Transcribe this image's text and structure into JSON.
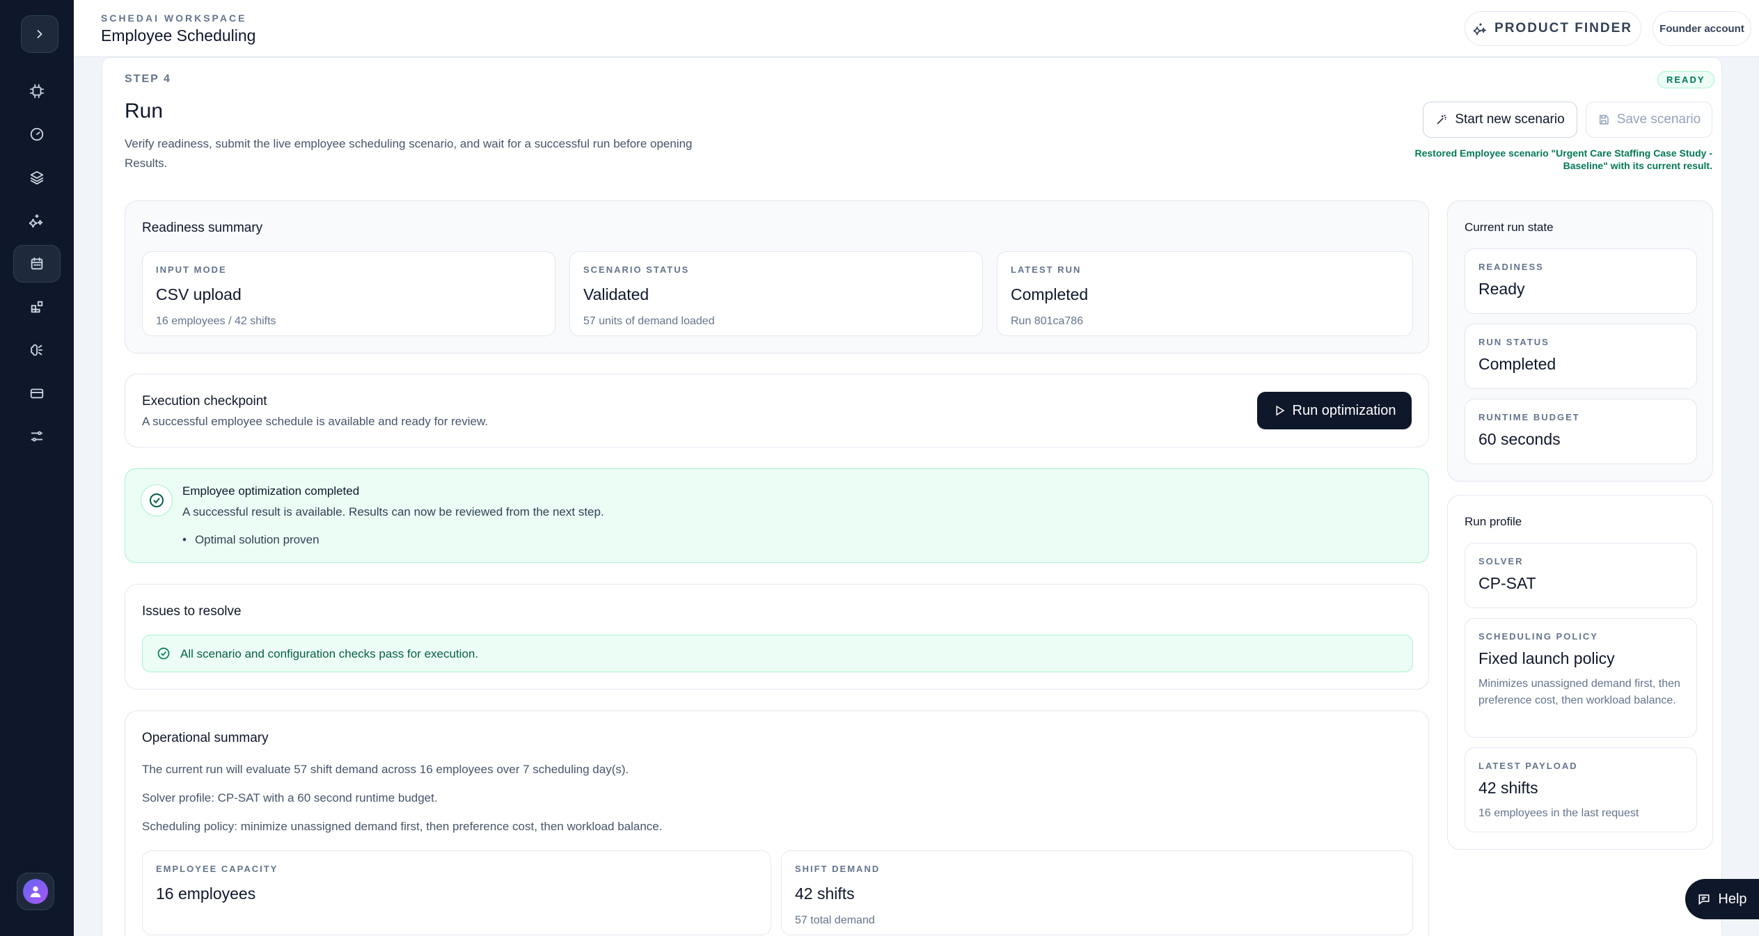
{
  "topbar": {
    "workspace_label": "SCHEDAI WORKSPACE",
    "title": "Employee Scheduling",
    "product_finder": "PRODUCT FINDER",
    "account": "Founder account"
  },
  "sidebar": {
    "items": [
      "cpu-icon",
      "gauge-icon",
      "layers-icon",
      "sparkles-icon",
      "calendar-icon",
      "blocks-icon",
      "brain-icon",
      "card-icon",
      "sliders-icon"
    ],
    "active": "calendar-icon"
  },
  "step": {
    "label": "STEP 4",
    "badge": "READY",
    "title": "Run",
    "description": "Verify readiness, submit the live employee scheduling scenario, and wait for a successful run before opening Results.",
    "start_new": "Start new scenario",
    "save": "Save scenario",
    "restored_msg": "Restored Employee scenario \"Urgent Care Staffing Case Study - Baseline\" with its current result."
  },
  "readiness": {
    "title": "Readiness summary",
    "cards": [
      {
        "label": "INPUT MODE",
        "value": "CSV upload",
        "sub": "16 employees / 42 shifts"
      },
      {
        "label": "SCENARIO STATUS",
        "value": "Validated",
        "sub": "57 units of demand loaded"
      },
      {
        "label": "LATEST RUN",
        "value": "Completed",
        "sub": "Run 801ca786"
      }
    ]
  },
  "execution": {
    "title": "Execution checkpoint",
    "subtitle": "A successful employee schedule is available and ready for review.",
    "run_button": "Run optimization"
  },
  "success": {
    "title": "Employee optimization completed",
    "message": "A successful result is available. Results can now be reviewed from the next step.",
    "bullet": "Optimal solution proven"
  },
  "issues": {
    "title": "Issues to resolve",
    "message": "All scenario and configuration checks pass for execution."
  },
  "operational": {
    "title": "Operational summary",
    "lines": [
      "The current run will evaluate 57 shift demand across 16 employees over 7 scheduling day(s).",
      "Solver profile: CP-SAT with a 60 second runtime budget.",
      "Scheduling policy: minimize unassigned demand first, then preference cost, then workload balance."
    ],
    "cards": [
      {
        "label": "EMPLOYEE CAPACITY",
        "value": "16 employees",
        "sub": ""
      },
      {
        "label": "SHIFT DEMAND",
        "value": "42 shifts",
        "sub": "57 total demand"
      }
    ]
  },
  "run_state": {
    "title": "Current run state",
    "cards": [
      {
        "label": "READINESS",
        "value": "Ready"
      },
      {
        "label": "RUN STATUS",
        "value": "Completed"
      },
      {
        "label": "RUNTIME BUDGET",
        "value": "60 seconds"
      }
    ]
  },
  "run_profile": {
    "title": "Run profile",
    "cards": [
      {
        "label": "SOLVER",
        "value": "CP-SAT",
        "sub": ""
      },
      {
        "label": "SCHEDULING POLICY",
        "value": "Fixed launch policy",
        "sub": "Minimizes unassigned demand first, then preference cost, then workload balance."
      },
      {
        "label": "LATEST PAYLOAD",
        "value": "42 shifts",
        "sub": "16 employees in the last request"
      }
    ]
  },
  "help": "Help"
}
